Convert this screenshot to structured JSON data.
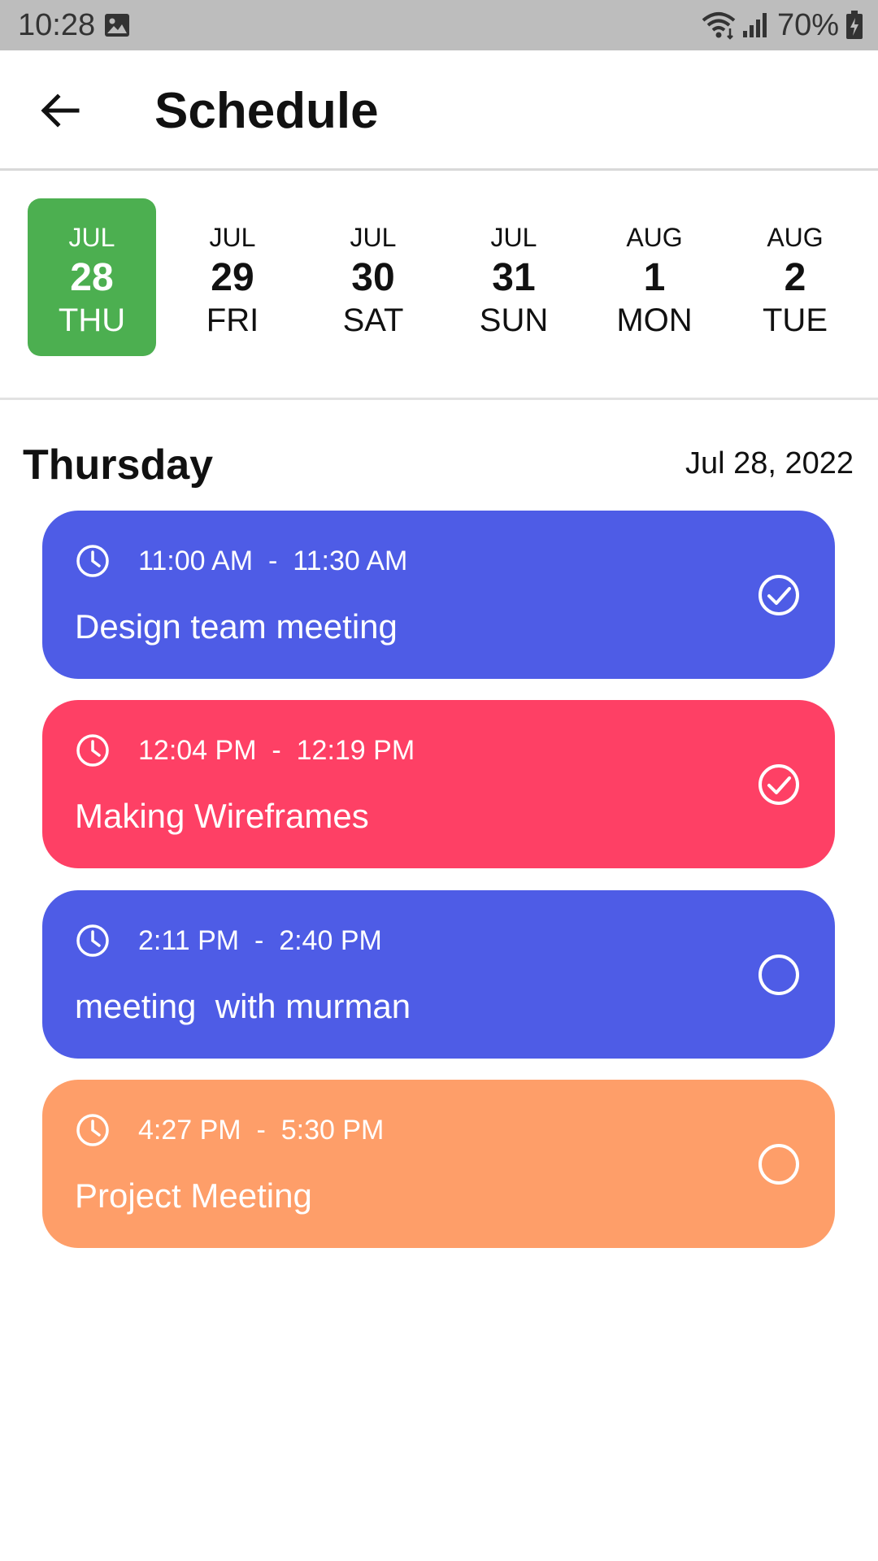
{
  "status_bar": {
    "time": "10:28",
    "battery": "70%",
    "icons": [
      "gallery-icon",
      "wifi-icon",
      "signal-icon",
      "battery-icon"
    ]
  },
  "app_bar": {
    "title": "Schedule",
    "back_icon": "arrow-left-icon"
  },
  "date_strip": {
    "selected_index": 0,
    "selected_color": "#4caf50",
    "days": [
      {
        "month": "JUL",
        "day": "28",
        "weekday": "THU"
      },
      {
        "month": "JUL",
        "day": "29",
        "weekday": "FRI"
      },
      {
        "month": "JUL",
        "day": "30",
        "weekday": "SAT"
      },
      {
        "month": "JUL",
        "day": "31",
        "weekday": "SUN"
      },
      {
        "month": "AUG",
        "day": "1",
        "weekday": "MON"
      },
      {
        "month": "AUG",
        "day": "2",
        "weekday": "TUE"
      }
    ]
  },
  "day_section": {
    "heading": "Thursday",
    "date": "Jul 28, 2022"
  },
  "events": [
    {
      "time": "11:00 AM  -  11:30 AM",
      "title": "Design team meeting",
      "color": "#4e5ce6",
      "completed": true
    },
    {
      "time": "12:04 PM  -  12:19 PM",
      "title": "Making Wireframes",
      "color": "#fe4065",
      "completed": true
    },
    {
      "time": "2:11 PM  -  2:40 PM",
      "title": "meeting  with murman",
      "color": "#4e5ce6",
      "completed": false
    },
    {
      "time": "4:27 PM  -  5:30 PM",
      "title": "Project Meeting",
      "color": "#fe9e69",
      "completed": false
    }
  ]
}
